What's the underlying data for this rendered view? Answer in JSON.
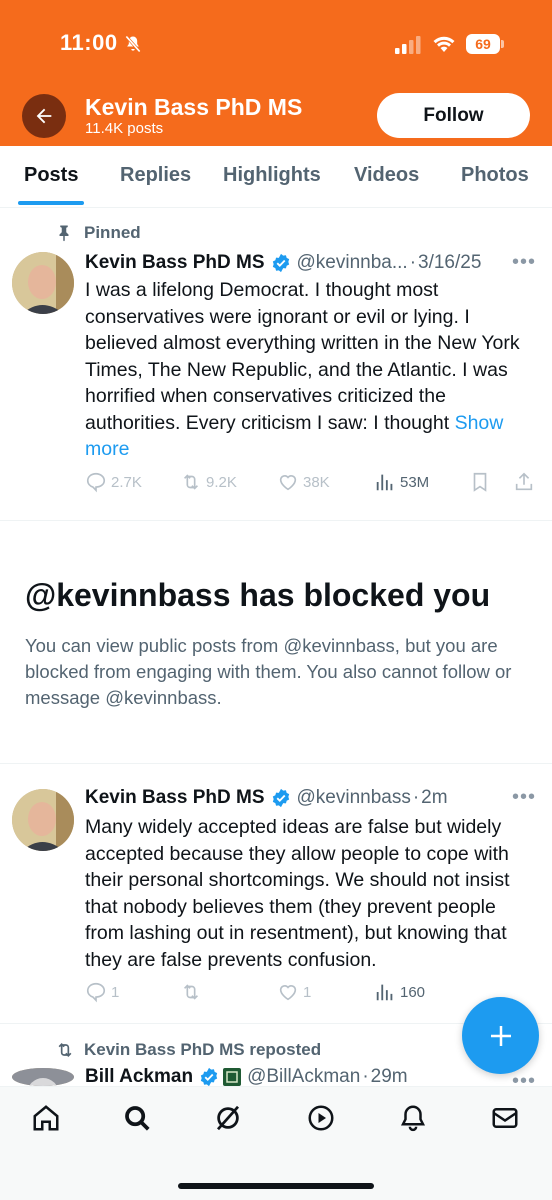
{
  "status_bar": {
    "time": "11:00",
    "battery": "69"
  },
  "profile": {
    "name": "Kevin Bass PhD MS",
    "posts_count": "11.4K posts",
    "follow_label": "Follow"
  },
  "tabs": [
    {
      "label": "Posts"
    },
    {
      "label": "Replies"
    },
    {
      "label": "Highlights"
    },
    {
      "label": "Videos"
    },
    {
      "label": "Photos"
    }
  ],
  "pinned_post": {
    "pinned_label": "Pinned",
    "author": "Kevin Bass PhD MS",
    "handle": "@kevinnba...",
    "date": "3/16/25",
    "text": "I was a lifelong Democrat. I thought most conservatives were ignorant or evil or lying. I believed almost everything written in the New York Times, The New Republic, and the Atlantic. I was horrified when conservatives criticized the authorities. Every criticism I saw: I thought",
    "show_more": "Show more",
    "replies": "2.7K",
    "reposts": "9.2K",
    "likes": "38K",
    "views": "53M"
  },
  "blocked": {
    "title": "@kevinnbass has blocked you",
    "description": "You can view public posts from @kevinnbass, but you are blocked from engaging with them. You also cannot follow or message @kevinnbass."
  },
  "second_post": {
    "author": "Kevin Bass PhD MS",
    "handle": "@kevinnbass",
    "time": "2m",
    "text": "Many widely accepted ideas are false but widely accepted because they allow people to cope with their personal shortcomings. We should not insist that nobody believes them (they prevent people from lashing out in resentment), but knowing that they are false prevents confusion.",
    "replies": "1",
    "likes": "1",
    "views": "160"
  },
  "repost": {
    "repost_label": "Kevin Bass PhD MS reposted",
    "author": "Bill Ackman",
    "handle": "@BillAckman",
    "time": "29m"
  },
  "colors": {
    "header_bg": "#f56b1c",
    "accent": "#1d9bf0",
    "text_primary": "#0f1419",
    "text_secondary": "#536471"
  },
  "icons": [
    "back-arrow-icon",
    "bell-off-icon",
    "signal-icon",
    "wifi-icon",
    "pin-icon",
    "verified-icon",
    "reply-icon",
    "repost-icon",
    "like-icon",
    "views-icon",
    "bookmark-icon",
    "share-icon",
    "plus-icon",
    "home-icon",
    "search-icon",
    "grok-icon",
    "video-icon",
    "notifications-icon",
    "messages-icon"
  ]
}
